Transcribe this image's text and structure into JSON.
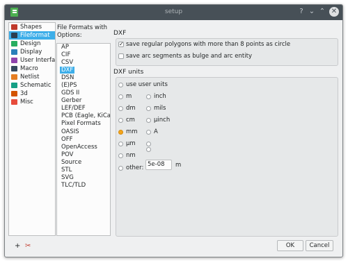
{
  "window": {
    "title": "setup"
  },
  "titlebar": {
    "help_glyph": "?",
    "minimize_glyph": "⌄",
    "maximize_glyph": "⌃",
    "close_glyph": "✕"
  },
  "categories": [
    {
      "label": "Shapes",
      "color": "#c0392b"
    },
    {
      "label": "Fileformat",
      "color": "#2c3e50",
      "selected": true
    },
    {
      "label": "Design",
      "color": "#27ae60"
    },
    {
      "label": "Display",
      "color": "#2980b9"
    },
    {
      "label": "User Interfac",
      "color": "#8e44ad"
    },
    {
      "label": "Macro",
      "color": "#34495e"
    },
    {
      "label": "Netlist",
      "color": "#e67e22"
    },
    {
      "label": "Schematic",
      "color": "#16a085"
    },
    {
      "label": "3d",
      "color": "#d35400"
    },
    {
      "label": "Misc",
      "color": "#e74c3c"
    }
  ],
  "formats_label": "File Formats with Options:",
  "formats": [
    "AP",
    "CIF",
    "CSV",
    "DXF",
    "DSN",
    "(E)PS",
    "GDS II",
    "Gerber",
    "LEF/DEF",
    "PCB (Eagle, KiCad",
    "Pixel Formats",
    "OASIS",
    "OFF",
    "OpenAccess",
    "POV",
    "Source",
    "STL",
    "SVG",
    "TLC/TLD"
  ],
  "selected_format": "DXF",
  "dxf": {
    "title": "DXF",
    "opt_polygons": "save regular polygons with more than 8 points as circle",
    "opt_arcs": "save arc segments as bulge and arc entity"
  },
  "units": {
    "title": "DXF units",
    "use_user_units": "use user units",
    "col1": [
      "m",
      "dm",
      "cm",
      "mm",
      "µm",
      "nm"
    ],
    "col2": [
      "inch",
      "mils",
      "µinch",
      "A",
      "",
      ""
    ],
    "selected": "mm",
    "other_label": "other:",
    "other_value": "5e-08",
    "other_unit": "m"
  },
  "bottom": {
    "add_glyph": "+",
    "tool_glyph": "✂"
  },
  "buttons": {
    "ok": "OK",
    "cancel": "Cancel"
  }
}
